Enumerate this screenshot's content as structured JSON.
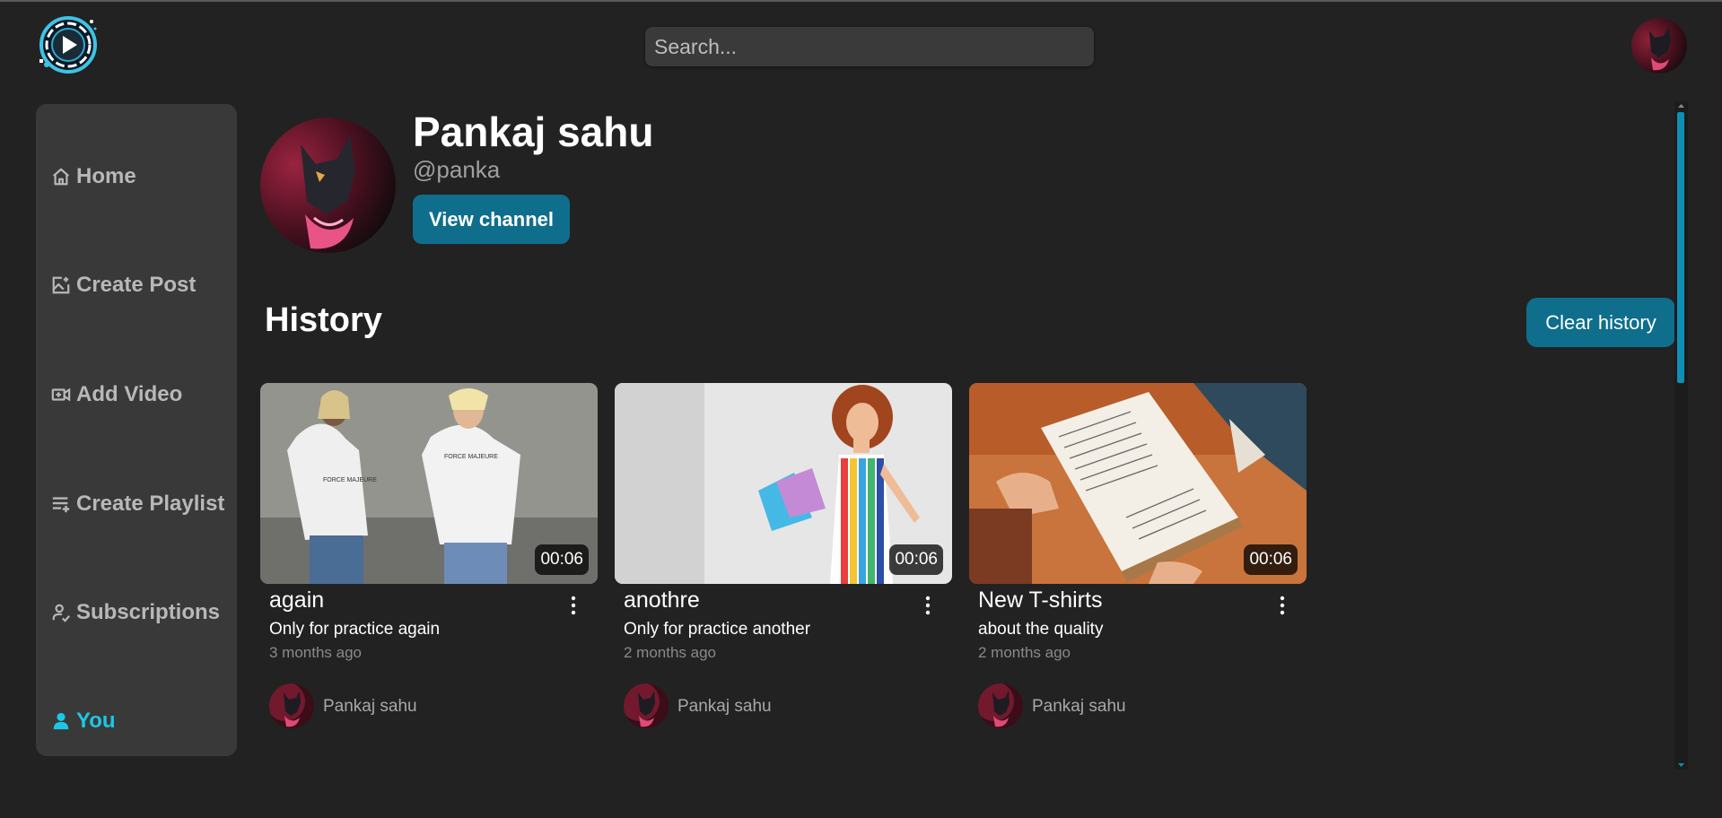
{
  "header": {
    "search_placeholder": "Search...",
    "logo_icon": "play-logo-icon",
    "avatar": "user-avatar"
  },
  "sidebar": {
    "items": [
      {
        "label": "Home",
        "icon": "home-icon",
        "active": false
      },
      {
        "label": "Create Post",
        "icon": "image-plus-icon",
        "active": false
      },
      {
        "label": "Add Video",
        "icon": "video-plus-icon",
        "active": false
      },
      {
        "label": "Create Playlist",
        "icon": "playlist-add-icon",
        "active": false
      },
      {
        "label": "Subscriptions",
        "icon": "user-check-icon",
        "active": false
      },
      {
        "label": "You",
        "icon": "user-icon",
        "active": true
      }
    ]
  },
  "profile": {
    "name": "Pankaj sahu",
    "handle": "@panka",
    "view_channel_label": "View channel"
  },
  "history": {
    "title": "History",
    "clear_label": "Clear history",
    "videos": [
      {
        "title": "again",
        "description": "Only for practice again",
        "time_ago": "3 months ago",
        "duration": "00:06",
        "owner": "Pankaj sahu",
        "thumbnail": "two-people-white-tshirts"
      },
      {
        "title": "anothre",
        "description": "Only for practice another",
        "time_ago": "2 months ago",
        "duration": "00:06",
        "owner": "Pankaj sahu",
        "thumbnail": "woman-shopping-bags"
      },
      {
        "title": "New T-shirts",
        "description": "about the quality",
        "time_ago": "2 months ago",
        "duration": "00:06",
        "owner": "Pankaj sahu",
        "thumbnail": "reading-book"
      }
    ]
  },
  "colors": {
    "background": "#222222",
    "sidebar": "#393939",
    "accent": "#0f6e8c",
    "active_nav": "#1ec6e6",
    "scroll_thumb": "#0e8fb5"
  }
}
